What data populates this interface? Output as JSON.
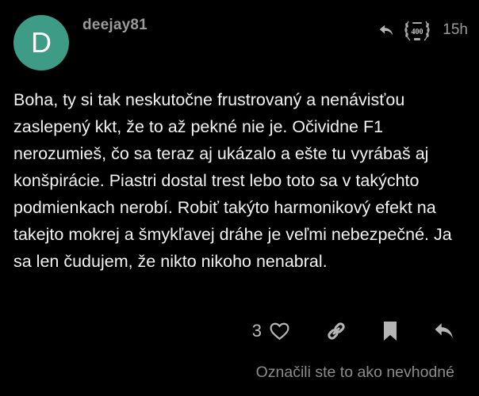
{
  "colors": {
    "background": "#000000",
    "avatar_bg": "#3e9b86",
    "text_primary": "#f2f2f2",
    "text_muted": "#9a9a9a",
    "icon_color": "#b5b5b5"
  },
  "post": {
    "avatar_letter": "D",
    "username": "deejay81",
    "reply_icon": "reply-arrow-icon",
    "badge_icon": "laurel-400-badge-icon",
    "badge_text": "400",
    "timestamp": "15h",
    "body": "Boha, ty si tak neskutočne frustrovaný a nenávisťou zaslepený kkt, že to až pekné nie je. Očividne F1 nerozumieš, čo sa teraz aj ukázalo a ešte tu vyrábaš aj konšpirácie. Piastri dostal trest lebo toto sa v takýchto podmienkach nerobí. Robiť takýto harmonikový efekt na takejto mokrej a šmykľavej dráhe je veľmi nebezpečné. Ja sa len čudujem, že nikto nikoho nenabral."
  },
  "actions": {
    "like_count": "3",
    "like_icon": "heart-icon",
    "link_icon": "link-icon",
    "bookmark_icon": "bookmark-icon",
    "reply_icon": "reply-icon"
  },
  "flag_status": "Označili ste to ako nevhodné"
}
